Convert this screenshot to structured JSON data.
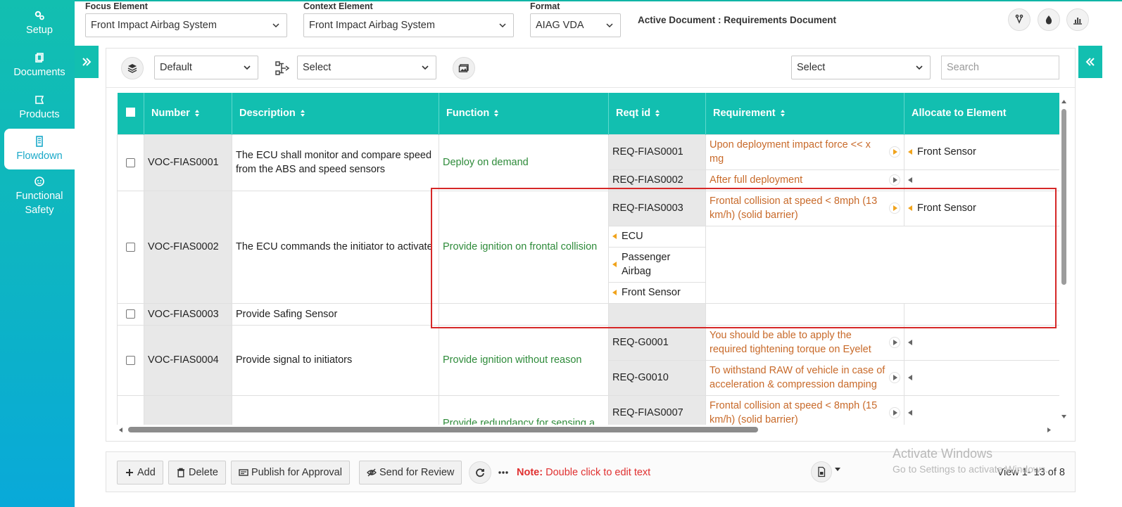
{
  "sidebar": {
    "items": [
      {
        "label": "Setup",
        "icon": "gears-icon"
      },
      {
        "label": "Documents",
        "icon": "documents-icon"
      },
      {
        "label": "Products",
        "icon": "products-icon"
      },
      {
        "label": "Flowdown",
        "icon": "flowdown-icon"
      },
      {
        "label": "Functional Safety",
        "icon": "functional-safety-icon"
      }
    ],
    "active": "Flowdown"
  },
  "header": {
    "focus_label": "Focus Element",
    "focus_value": "Front Impact Airbag System",
    "context_label": "Context Element",
    "context_value": "Front Impact Airbag System",
    "format_label": "Format",
    "format_value": "AIAG VDA",
    "active_doc": "Active Document : Requirements Document"
  },
  "toolbar": {
    "layout_select": "Default",
    "hierarchy_select": "Select",
    "filter_select": "Select",
    "search_placeholder": "Search"
  },
  "grid": {
    "columns": [
      "Number",
      "Description",
      "Function",
      "Reqt id",
      "Requirement",
      "Allocate to Element"
    ],
    "rows": [
      {
        "number": "VOC-FIAS0001",
        "description": "The ECU shall monitor and compare speed from the ABS and speed sensors",
        "function": "Deploy on demand",
        "reqs": [
          {
            "id": "REQ-FIAS0001",
            "text": "Upon deployment impact force << x mg",
            "alloc": "Front Sensor"
          },
          {
            "id": "REQ-FIAS0002",
            "text": "After full deployment",
            "alloc": ""
          }
        ]
      },
      {
        "number": "VOC-FIAS0002",
        "description": "The ECU commands the initiator to activate",
        "function": "Provide ignition on frontal collision",
        "reqs": [
          {
            "id": "REQ-FIAS0003",
            "text": "Frontal collision at speed < 8mph (13 km/h) (solid barrier)",
            "alloc": "Front Sensor"
          }
        ],
        "elements": [
          "ECU",
          "Passenger Airbag",
          "Front Sensor"
        ]
      },
      {
        "number": "VOC-FIAS0003",
        "description": "Provide Safing Sensor",
        "function": "",
        "reqs": []
      },
      {
        "number": "VOC-FIAS0004",
        "description": "Provide signal to initiators",
        "function": "Provide ignition without reason",
        "reqs": [
          {
            "id": "REQ-G0001",
            "text": "You should be able to apply the required tightening torque on Eyelet",
            "alloc": ""
          },
          {
            "id": "REQ-G0010",
            "text": "To withstand RAW of vehicle in case of acceleration & compression damping",
            "alloc": ""
          }
        ]
      },
      {
        "number": "",
        "description": "",
        "function": "Provide redundancy for sensing a",
        "reqs": [
          {
            "id": "REQ-FIAS0007",
            "text": "Frontal collision at speed < 8mph (15 km/h) (solid barrier)",
            "alloc": ""
          }
        ]
      }
    ]
  },
  "footer": {
    "add": "Add",
    "delete": "Delete",
    "publish": "Publish for Approval",
    "review": "Send for Review",
    "note_label": "Note:",
    "note_text": " Double click to edit text",
    "view": "View 1- 13 of 8"
  },
  "watermark": {
    "title": "Activate Windows",
    "sub": "Go to Settings to activate Windows."
  },
  "colors": {
    "accent": "#12bfb0",
    "function_text": "#2e8b3a",
    "requirement_text": "#c86a2a",
    "note": "#e03030",
    "highlight": "#d62828"
  }
}
